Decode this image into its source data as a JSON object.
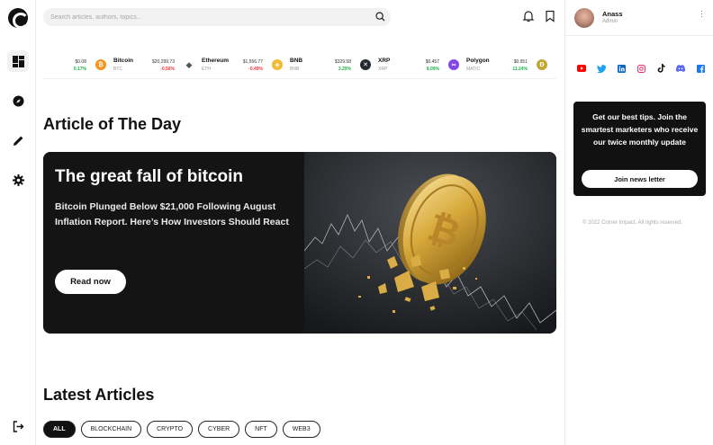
{
  "search": {
    "placeholder": "Search articles, authors, topics..."
  },
  "ticker": [
    {
      "name": "",
      "symbol": "",
      "price": "$0.08",
      "change": "0.17%",
      "direction": "up",
      "icon": "partial-coin",
      "color": "#f3ba2f",
      "glyph": ""
    },
    {
      "name": "Bitcoin",
      "symbol": "BTC",
      "price": "$20,299.73",
      "change": "-0.56%",
      "direction": "down",
      "icon": "bitcoin-icon",
      "color": "#f7931a",
      "glyph": "₿"
    },
    {
      "name": "Ethereum",
      "symbol": "ETH",
      "price": "$1,556.77",
      "change": "-0.49%",
      "direction": "down",
      "icon": "ethereum-icon",
      "color": "#ffffff",
      "glyph": "◆"
    },
    {
      "name": "BNB",
      "symbol": "BNB",
      "price": "$329.58",
      "change": "3.29%",
      "direction": "up",
      "icon": "bnb-icon",
      "color": "#f3ba2f",
      "glyph": "◈"
    },
    {
      "name": "XRP",
      "symbol": "XRP",
      "price": "$0.457",
      "change": "8.09%",
      "direction": "up",
      "icon": "xrp-icon",
      "color": "#23292f",
      "glyph": "✕"
    },
    {
      "name": "Polygon",
      "symbol": "MATIC",
      "price": "$0.951",
      "change": "11.24%",
      "direction": "up",
      "icon": "polygon-icon",
      "color": "#8247e5",
      "glyph": "∞"
    },
    {
      "name": "",
      "symbol": "",
      "price": "",
      "change": "",
      "direction": "up",
      "icon": "dogecoin-icon",
      "color": "#c2a633",
      "glyph": "Ð"
    }
  ],
  "article_of_day": {
    "heading": "Article of The Day",
    "title": "The great fall of bitcoin",
    "description": "Bitcoin Plunged Below $21,000 Following August Inflation Report. Here’s How Investors Should React",
    "cta": "Read now"
  },
  "latest": {
    "heading": "Latest Articles",
    "filters": [
      "ALL",
      "BLOCKCHAIN",
      "CRYPTO",
      "CYBER",
      "NFT",
      "WEB3"
    ],
    "active_filter": "ALL"
  },
  "profile": {
    "name": "Anass",
    "role": "Admin"
  },
  "socials": [
    {
      "icon": "youtube-icon",
      "color": "#ff0000"
    },
    {
      "icon": "twitter-icon",
      "color": "#1da1f2"
    },
    {
      "icon": "linkedin-icon",
      "color": "#0a66c2"
    },
    {
      "icon": "instagram-icon",
      "color": "#e1306c"
    },
    {
      "icon": "tiktok-icon",
      "color": "#111111"
    },
    {
      "icon": "discord-icon",
      "color": "#5865f2"
    },
    {
      "icon": "facebook-icon",
      "color": "#1877f2"
    }
  ],
  "newsletter": {
    "text": "Get our best tips. Join the smartest marketers who receive our twice monthly update",
    "button": "Join news letter"
  },
  "footer": {
    "copyright": "© 2022 Coiner Impact. All rights reserved."
  }
}
